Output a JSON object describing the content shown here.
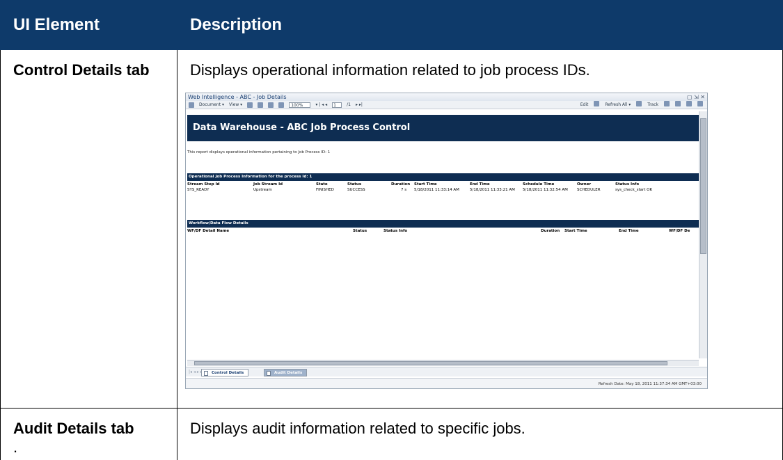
{
  "table": {
    "header": {
      "col1": "UI Element",
      "col2": "Description"
    },
    "rows": [
      {
        "element": "Control Details tab",
        "description": "Displays operational information related to job process IDs."
      },
      {
        "element": "Audit Details tab",
        "element_suffix": ".",
        "description": "Displays audit information related to specific jobs."
      }
    ]
  },
  "screenshot": {
    "window_title": "Web Intelligence - ABC - Job Details",
    "window_controls": "▢ ⇲ ✕",
    "toolbar": {
      "document": "Document ▾",
      "view": "View ▾",
      "zoom": "100%",
      "page_nav_left": "▾ | ◂ ◂",
      "page": "1",
      "page_total": "/1",
      "page_nav_right": "▸ ▸|",
      "edit": "Edit",
      "refresh_all": "Refresh All ▾",
      "track": "Track"
    },
    "report": {
      "title": "Data Warehouse - ABC Job Process Control",
      "intro": "This report displays operational information pertaining to Job Process ID:  1",
      "section1_title": "Operational Job Process Information for the process Id: 1",
      "section1_headers": [
        "Stream Step Id",
        "Job Stream Id",
        "State",
        "Status",
        "Duration",
        "Start Time",
        "End Time",
        "Schedule Time",
        "Owner",
        "Status Info"
      ],
      "section1_rows": [
        [
          "SYS_READY",
          "Upstream",
          "FINISHED",
          "SUCCESS",
          "7 s",
          "5/18/2011 11:33:14 AM",
          "5/18/2011 11:33:21 AM",
          "5/18/2011 11:32:54 AM",
          "SCHEDULER",
          "sys_check_start OK"
        ]
      ],
      "section2_title": "Workflow/Data Flow Details",
      "section2_headers": [
        "WF/DF Detail Name",
        "Status",
        "Status Info",
        "Duration",
        "Start Time",
        "End Time",
        "WF/DF De"
      ]
    },
    "tabs": [
      {
        "label": "Control Details",
        "active": true
      },
      {
        "label": "Audit Details",
        "active": false
      }
    ],
    "nav_arrows": "|◂ ◂ ▸ ▸|",
    "status": "Refresh Date: May 18, 2011 11:37:34 AM GMT+03:00"
  }
}
